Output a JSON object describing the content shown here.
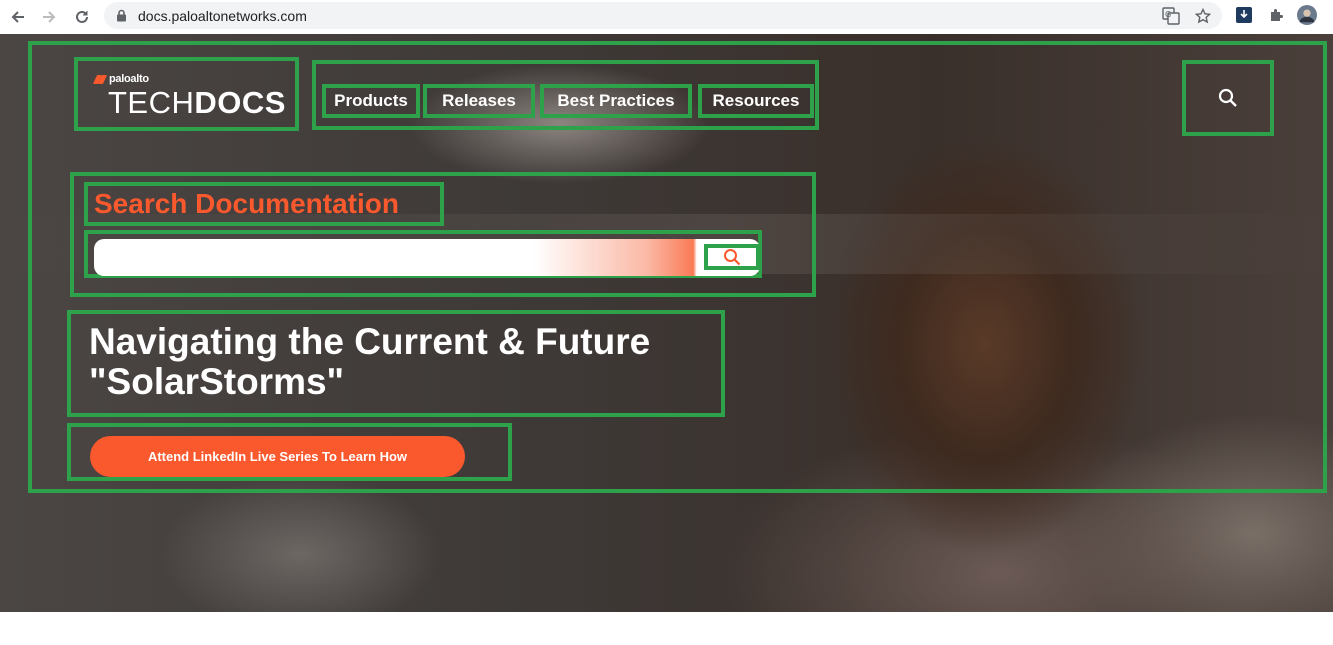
{
  "browser": {
    "url": "docs.paloaltonetworks.com",
    "icons": [
      "back-arrow-icon",
      "forward-arrow-icon",
      "reload-icon",
      "lock-icon",
      "translate-icon",
      "star-icon",
      "download-icon",
      "puzzle-icon",
      "profile-avatar"
    ]
  },
  "site": {
    "brand_small": "paloalto",
    "brand_word_light": "TECH",
    "brand_word_bold": "DOCS",
    "accent_color": "#fa582d"
  },
  "nav": {
    "items": [
      "Products",
      "Releases",
      "Best Practices",
      "Resources"
    ],
    "search_icon": "search-icon"
  },
  "search": {
    "title": "Search Documentation",
    "value": "",
    "placeholder": ""
  },
  "hero": {
    "headline_line1": "Navigating the Current & Future",
    "headline_line2": "\"SolarStorms\"",
    "cta_label": "Attend LinkedIn Live Series To Learn How"
  }
}
